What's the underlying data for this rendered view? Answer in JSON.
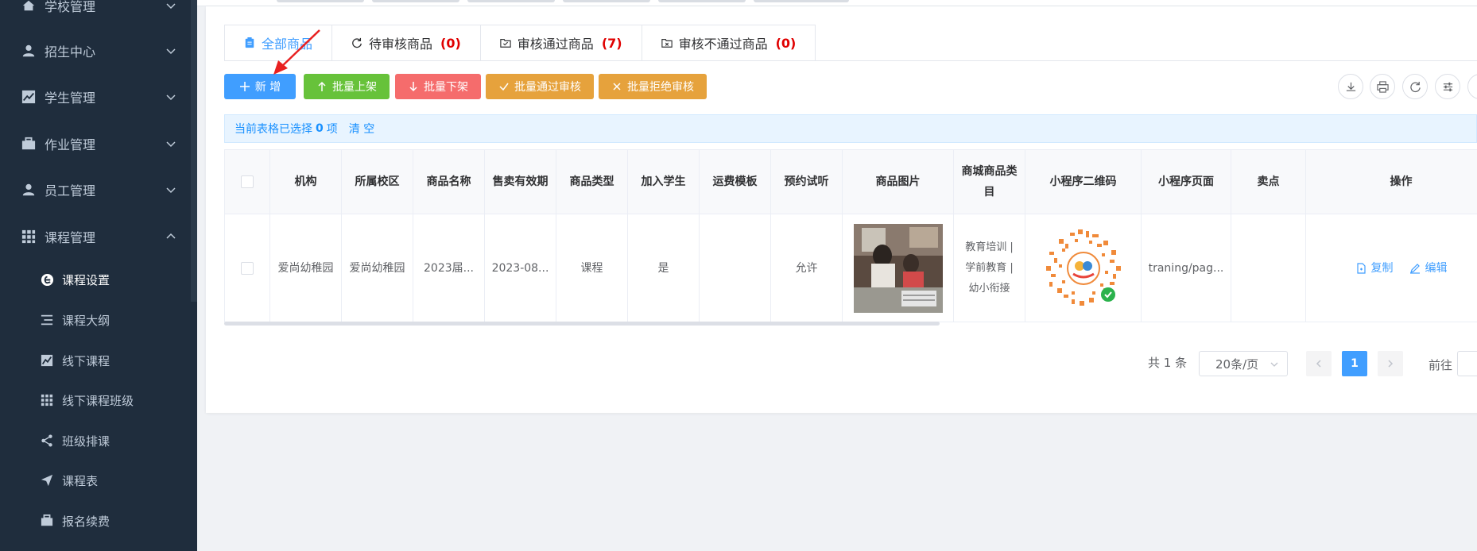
{
  "sidebar": {
    "items": [
      {
        "label": "学校管理",
        "icon": "home-icon"
      },
      {
        "label": "招生中心",
        "icon": "user-icon"
      },
      {
        "label": "学生管理",
        "icon": "chart-icon"
      },
      {
        "label": "作业管理",
        "icon": "briefcase-icon"
      },
      {
        "label": "员工管理",
        "icon": "user-icon"
      },
      {
        "label": "课程管理",
        "icon": "grid-icon"
      }
    ],
    "sub_items": [
      {
        "label": "课程设置",
        "icon": "edge-icon",
        "active": true
      },
      {
        "label": "课程大纲",
        "icon": "list-icon"
      },
      {
        "label": "线下课程",
        "icon": "chart-icon"
      },
      {
        "label": "线下课程班级",
        "icon": "grid-icon"
      },
      {
        "label": "班级排课",
        "icon": "share-icon"
      },
      {
        "label": "课程表",
        "icon": "send-icon"
      },
      {
        "label": "报名续费",
        "icon": "briefcase-icon"
      }
    ]
  },
  "tabs": [
    {
      "label": "全部商品",
      "count": "",
      "icon": "clipboard-icon"
    },
    {
      "label": "待审核商品",
      "count": "(0)",
      "icon": "refresh-icon"
    },
    {
      "label": "审核通过商品",
      "count": "(7)",
      "icon": "folder-check-icon"
    },
    {
      "label": "审核不通过商品",
      "count": "(0)",
      "icon": "folder-x-icon"
    }
  ],
  "toolbar": {
    "add": "新 增",
    "batch_on": "批量上架",
    "batch_off": "批量下架",
    "batch_approve": "批量通过审核",
    "batch_reject": "批量拒绝审核"
  },
  "selection": {
    "prefix": "当前表格已选择",
    "count": "0",
    "suffix": "项",
    "clear": "清 空"
  },
  "table": {
    "headers": [
      "机构",
      "所属校区",
      "商品名称",
      "售卖有效期",
      "商品类型",
      "加入学生",
      "运费模板",
      "预约试听",
      "商品图片",
      "商城商品类目",
      "小程序二维码",
      "小程序页面",
      "卖点",
      "操作"
    ],
    "rows": [
      {
        "org": "爱尚幼稚园",
        "campus": "爱尚幼稚园",
        "name": "2023届...",
        "period": "2023-08...",
        "type": "课程",
        "join": "是",
        "freight": "",
        "trial": "允许",
        "category": "教育培训 | 学前教育 | 幼小衔接",
        "page": "traning/pag...",
        "selling": "",
        "copy": "复制",
        "edit": "编辑"
      }
    ]
  },
  "pagination": {
    "total": "共 1 条",
    "page_size": "20条/页",
    "current": "1",
    "goto": "前往"
  },
  "colors": {
    "primary": "#409eff",
    "success": "#67c23a",
    "danger": "#f56c6c",
    "warning": "#e6a23c",
    "sidebar": "#1f2d3d"
  }
}
